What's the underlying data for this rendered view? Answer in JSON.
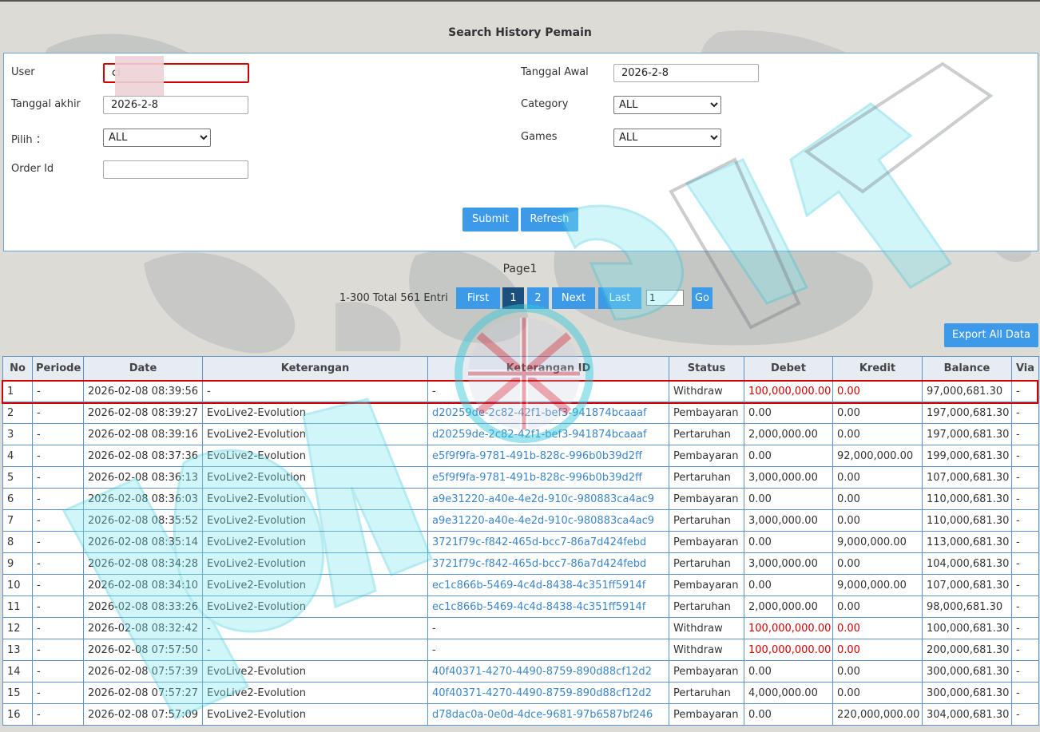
{
  "title": "Search History Pemain",
  "form": {
    "user_label": "User",
    "user_value": "ci",
    "tanggal_awal_label": "Tanggal Awal",
    "tanggal_awal_value": "2026-2-8",
    "tanggal_akhir_label": "Tanggal akhir",
    "tanggal_akhir_value": "2026-2-8",
    "category_label": "Category",
    "category_value": "ALL",
    "pilih_label": "Pilih ：",
    "pilih_value": "ALL",
    "games_label": "Games",
    "games_value": "ALL",
    "order_id_label": "Order Id",
    "order_id_value": "",
    "submit_label": "Submit",
    "refresh_label": "Refresh"
  },
  "pagination": {
    "page_label": "Page1",
    "entries_text": "1-300 Total 561 Entri",
    "first_label": "First",
    "page1_label": "1",
    "page2_label": "2",
    "next_label": "Next",
    "last_label": "Last",
    "page_input": "1",
    "go_label": "Go"
  },
  "export_label": "Export All Data",
  "watermark": "LONDON4SLOT",
  "table": {
    "headers": [
      "No",
      "Periode",
      "Date",
      "Keterangan",
      "Keterangan ID",
      "Status",
      "Debet",
      "Kredit",
      "Balance",
      "Via"
    ],
    "rows": [
      [
        "1",
        "-",
        "2026-02-08 08:39:56",
        "-",
        "-",
        "Withdraw",
        "100,000,000.00",
        "0.00",
        "97,000,681.30",
        "-"
      ],
      [
        "2",
        "-",
        "2026-02-08 08:39:27",
        "EvoLive2-Evolution",
        "d20259de-2c82-42f1-bef3-941874bcaaaf",
        "Pembayaran",
        "0.00",
        "0.00",
        "197,000,681.30",
        "-"
      ],
      [
        "3",
        "-",
        "2026-02-08 08:39:16",
        "EvoLive2-Evolution",
        "d20259de-2c82-42f1-bef3-941874bcaaaf",
        "Pertaruhan",
        "2,000,000.00",
        "0.00",
        "197,000,681.30",
        "-"
      ],
      [
        "4",
        "-",
        "2026-02-08 08:37:36",
        "EvoLive2-Evolution",
        "e5f9f9fa-9781-491b-828c-996b0b39d2ff",
        "Pembayaran",
        "0.00",
        "92,000,000.00",
        "199,000,681.30",
        "-"
      ],
      [
        "5",
        "-",
        "2026-02-08 08:36:13",
        "EvoLive2-Evolution",
        "e5f9f9fa-9781-491b-828c-996b0b39d2ff",
        "Pertaruhan",
        "3,000,000.00",
        "0.00",
        "107,000,681.30",
        "-"
      ],
      [
        "6",
        "-",
        "2026-02-08 08:36:03",
        "EvoLive2-Evolution",
        "a9e31220-a40e-4e2d-910c-980883ca4ac9",
        "Pembayaran",
        "0.00",
        "0.00",
        "110,000,681.30",
        "-"
      ],
      [
        "7",
        "-",
        "2026-02-08 08:35:52",
        "EvoLive2-Evolution",
        "a9e31220-a40e-4e2d-910c-980883ca4ac9",
        "Pertaruhan",
        "3,000,000.00",
        "0.00",
        "110,000,681.30",
        "-"
      ],
      [
        "8",
        "-",
        "2026-02-08 08:35:14",
        "EvoLive2-Evolution",
        "3721f79c-f842-465d-bcc7-86a7d424febd",
        "Pembayaran",
        "0.00",
        "9,000,000.00",
        "113,000,681.30",
        "-"
      ],
      [
        "9",
        "-",
        "2026-02-08 08:34:28",
        "EvoLive2-Evolution",
        "3721f79c-f842-465d-bcc7-86a7d424febd",
        "Pertaruhan",
        "3,000,000.00",
        "0.00",
        "104,000,681.30",
        "-"
      ],
      [
        "10",
        "-",
        "2026-02-08 08:34:10",
        "EvoLive2-Evolution",
        "ec1c866b-5469-4c4d-8438-4c351ff5914f",
        "Pembayaran",
        "0.00",
        "9,000,000.00",
        "107,000,681.30",
        "-"
      ],
      [
        "11",
        "-",
        "2026-02-08 08:33:26",
        "EvoLive2-Evolution",
        "ec1c866b-5469-4c4d-8438-4c351ff5914f",
        "Pertaruhan",
        "2,000,000.00",
        "0.00",
        "98,000,681.30",
        "-"
      ],
      [
        "12",
        "-",
        "2026-02-08 08:32:42",
        "-",
        "-",
        "Withdraw",
        "100,000,000.00",
        "0.00",
        "100,000,681.30",
        "-"
      ],
      [
        "13",
        "-",
        "2026-02-08 07:57:50",
        "-",
        "-",
        "Withdraw",
        "100,000,000.00",
        "0.00",
        "200,000,681.30",
        "-"
      ],
      [
        "14",
        "-",
        "2026-02-08 07:57:39",
        "EvoLive2-Evolution",
        "40f40371-4270-4490-8759-890d88cf12d2",
        "Pembayaran",
        "0.00",
        "0.00",
        "300,000,681.30",
        "-"
      ],
      [
        "15",
        "-",
        "2026-02-08 07:57:27",
        "EvoLive2-Evolution",
        "40f40371-4270-4490-8759-890d88cf12d2",
        "Pertaruhan",
        "4,000,000.00",
        "0.00",
        "300,000,681.30",
        "-"
      ],
      [
        "16",
        "-",
        "2026-02-08 07:57:09",
        "EvoLive2-Evolution",
        "d78dac0a-0e0d-4dce-9681-97b6587bf246",
        "Pembayaran",
        "0.00",
        "220,000,000.00",
        "304,000,681.30",
        "-"
      ]
    ]
  },
  "colors": {
    "accent": "#3d9ae8",
    "active_page": "#1b4f7e",
    "highlight": "#d20000",
    "link": "#3c86c7"
  }
}
